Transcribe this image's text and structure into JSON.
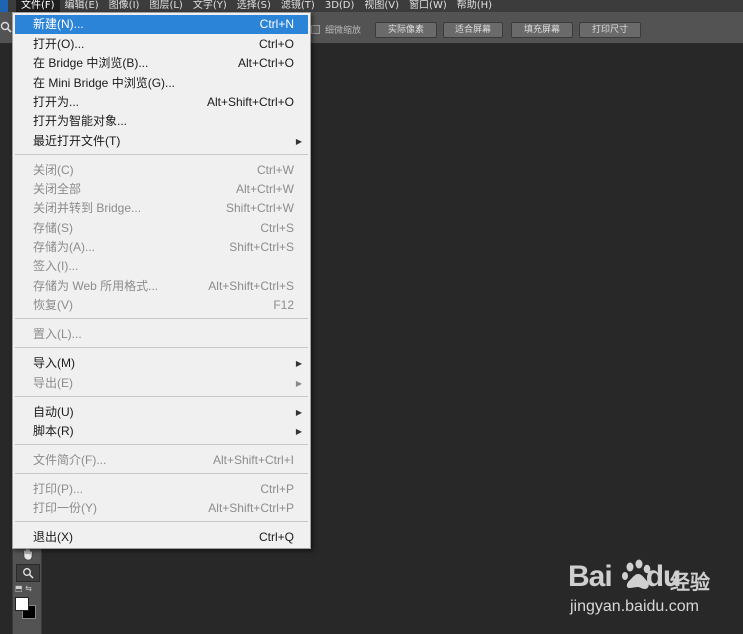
{
  "menubar": {
    "items": [
      {
        "label": "文件(F)"
      },
      {
        "label": "编辑(E)"
      },
      {
        "label": "图像(I)"
      },
      {
        "label": "图层(L)"
      },
      {
        "label": "文字(Y)"
      },
      {
        "label": "选择(S)"
      },
      {
        "label": "滤镜(T)"
      },
      {
        "label": "3D(D)"
      },
      {
        "label": "视图(V)"
      },
      {
        "label": "窗口(W)"
      },
      {
        "label": "帮助(H)"
      }
    ]
  },
  "options_bar": {
    "scrubby_zoom_label": "细微缩放",
    "buttons": [
      "实际像素",
      "适合屏幕",
      "填充屏幕",
      "打印尺寸"
    ]
  },
  "file_menu": {
    "items": [
      {
        "label": "新建(N)...",
        "shortcut": "Ctrl+N",
        "state": "highlighted"
      },
      {
        "label": "打开(O)...",
        "shortcut": "Ctrl+O",
        "state": "enabled"
      },
      {
        "label": "在 Bridge 中浏览(B)...",
        "shortcut": "Alt+Ctrl+O",
        "state": "enabled"
      },
      {
        "label": "在 Mini Bridge 中浏览(G)...",
        "shortcut": "",
        "state": "enabled"
      },
      {
        "label": "打开为...",
        "shortcut": "Alt+Shift+Ctrl+O",
        "state": "enabled"
      },
      {
        "label": "打开为智能对象...",
        "shortcut": "",
        "state": "enabled"
      },
      {
        "label": "最近打开文件(T)",
        "shortcut": "",
        "state": "enabled",
        "submenu": true
      },
      {
        "label": "关闭(C)",
        "shortcut": "Ctrl+W",
        "state": "disabled"
      },
      {
        "label": "关闭全部",
        "shortcut": "Alt+Ctrl+W",
        "state": "disabled"
      },
      {
        "label": "关闭并转到 Bridge...",
        "shortcut": "Shift+Ctrl+W",
        "state": "disabled"
      },
      {
        "label": "存储(S)",
        "shortcut": "Ctrl+S",
        "state": "disabled"
      },
      {
        "label": "存储为(A)...",
        "shortcut": "Shift+Ctrl+S",
        "state": "disabled"
      },
      {
        "label": "签入(I)...",
        "shortcut": "",
        "state": "disabled"
      },
      {
        "label": "存储为 Web 所用格式...",
        "shortcut": "Alt+Shift+Ctrl+S",
        "state": "disabled"
      },
      {
        "label": "恢复(V)",
        "shortcut": "F12",
        "state": "disabled"
      },
      {
        "label": "置入(L)...",
        "shortcut": "",
        "state": "disabled"
      },
      {
        "label": "导入(M)",
        "shortcut": "",
        "state": "enabled",
        "submenu": true
      },
      {
        "label": "导出(E)",
        "shortcut": "",
        "state": "disabled",
        "submenu": true
      },
      {
        "label": "自动(U)",
        "shortcut": "",
        "state": "enabled",
        "submenu": true
      },
      {
        "label": "脚本(R)",
        "shortcut": "",
        "state": "enabled",
        "submenu": true
      },
      {
        "label": "文件简介(F)...",
        "shortcut": "Alt+Shift+Ctrl+I",
        "state": "disabled"
      },
      {
        "label": "打印(P)...",
        "shortcut": "Ctrl+P",
        "state": "disabled"
      },
      {
        "label": "打印一份(Y)",
        "shortcut": "Alt+Shift+Ctrl+P",
        "state": "disabled"
      },
      {
        "label": "退出(X)",
        "shortcut": "Ctrl+Q",
        "state": "enabled"
      }
    ]
  },
  "toolbox": {
    "tools": [
      {
        "icon": "hand-icon"
      },
      {
        "icon": "zoom-icon",
        "selected": true
      }
    ]
  },
  "watermark": {
    "brand_bai": "Bai",
    "brand_du": "du",
    "brand_jingyan": "经验",
    "url": "jingyan.baidu.com"
  },
  "colors": {
    "highlight": "#2c84d8",
    "menu_bg": "#f0f0f0",
    "workspace_bg": "#282828"
  }
}
